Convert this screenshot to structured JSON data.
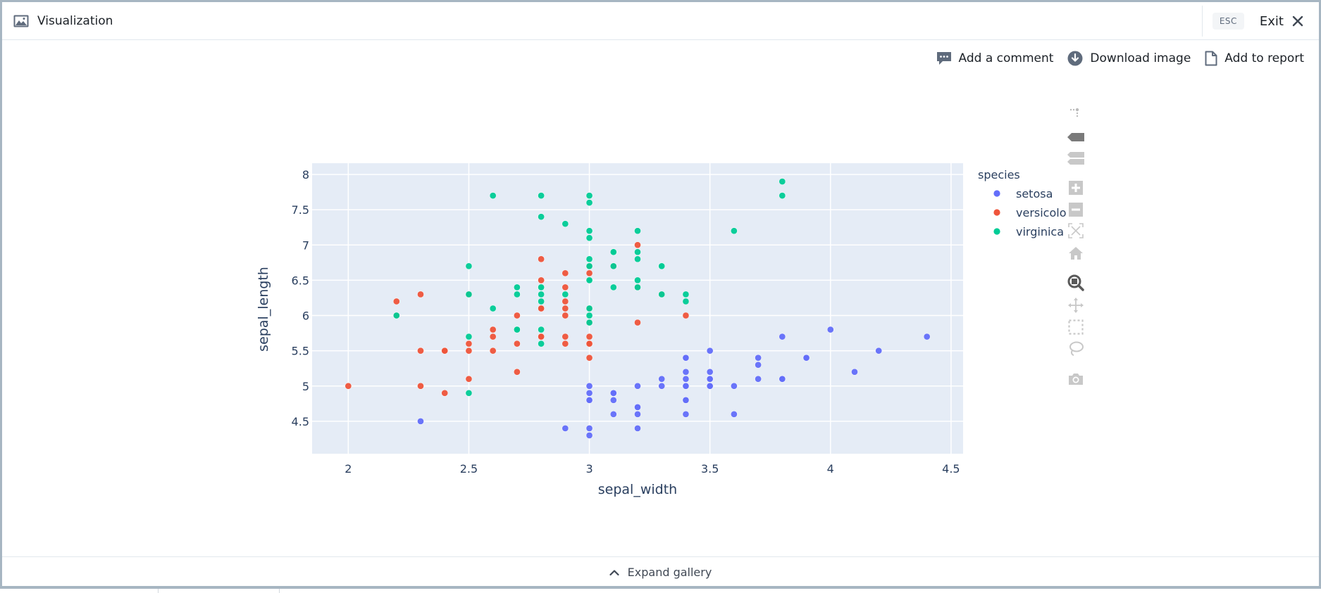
{
  "header": {
    "title": "Visualization",
    "title_icon": "image-icon",
    "esc_label": "ESC",
    "exit_label": "Exit"
  },
  "actions": [
    {
      "label": "Add a comment",
      "icon": "comment-icon"
    },
    {
      "label": "Download image",
      "icon": "download-icon"
    },
    {
      "label": "Add to report",
      "icon": "document-icon"
    }
  ],
  "modebar": [
    {
      "name": "plotly-logo-icon"
    },
    {
      "name": "show-closest-icon"
    },
    {
      "name": "compare-data-icon"
    },
    {
      "name": "zoom-in-icon"
    },
    {
      "name": "zoom-out-icon"
    },
    {
      "name": "autoscale-icon"
    },
    {
      "name": "reset-axes-icon"
    },
    {
      "name": "zoom-icon",
      "active": true
    },
    {
      "name": "pan-icon"
    },
    {
      "name": "box-select-icon"
    },
    {
      "name": "lasso-select-icon"
    },
    {
      "name": "camera-icon"
    }
  ],
  "footer": {
    "expand_label": "Expand gallery"
  },
  "chart_data": {
    "type": "scatter",
    "title": "",
    "xlabel": "sepal_width",
    "ylabel": "sepal_length",
    "xlim": [
      1.85,
      4.55
    ],
    "ylim": [
      4.04,
      8.16
    ],
    "xticks": [
      2,
      2.5,
      3,
      3.5,
      4,
      4.5
    ],
    "xtick_labels": [
      "2",
      "2.5",
      "3",
      "3.5",
      "4",
      "4.5"
    ],
    "yticks": [
      4.5,
      5,
      5.5,
      6,
      6.5,
      7,
      7.5,
      8
    ],
    "ytick_labels": [
      "4.5",
      "5",
      "5.5",
      "6",
      "6.5",
      "7",
      "7.5",
      "8"
    ],
    "grid": true,
    "plot_bgcolor": "#e5ecf6",
    "legend": {
      "title": "species",
      "position": "right"
    },
    "series": [
      {
        "name": "setosa",
        "color": "#636efa",
        "x": [
          3.5,
          3.0,
          3.2,
          3.1,
          3.6,
          3.9,
          3.4,
          3.4,
          2.9,
          3.1,
          3.7,
          3.4,
          3.0,
          3.0,
          4.0,
          4.4,
          3.9,
          3.5,
          3.8,
          3.8,
          3.4,
          3.7,
          3.6,
          3.3,
          3.4,
          3.0,
          3.4,
          3.5,
          3.4,
          3.2,
          3.1,
          3.4,
          4.1,
          4.2,
          3.1,
          3.2,
          3.5,
          3.1,
          3.0,
          3.4,
          3.5,
          2.3,
          3.2,
          3.5,
          3.8,
          3.0,
          3.8,
          3.2,
          3.7,
          3.3
        ],
        "y": [
          5.1,
          4.9,
          4.7,
          4.6,
          5.0,
          5.4,
          4.6,
          5.0,
          4.4,
          4.9,
          5.4,
          4.8,
          4.8,
          4.3,
          5.8,
          5.7,
          5.4,
          5.1,
          5.7,
          5.1,
          5.4,
          5.1,
          4.6,
          5.1,
          4.8,
          5.0,
          5.0,
          5.2,
          5.2,
          4.7,
          4.8,
          5.4,
          5.2,
          5.5,
          4.9,
          5.0,
          5.5,
          4.9,
          4.4,
          5.1,
          5.0,
          4.5,
          4.4,
          5.0,
          5.1,
          4.8,
          5.1,
          4.6,
          5.3,
          5.0
        ]
      },
      {
        "name": "versicolor",
        "color": "#ef553b",
        "x": [
          3.2,
          3.2,
          3.1,
          2.3,
          2.8,
          2.8,
          3.3,
          2.4,
          2.9,
          2.7,
          2.0,
          3.0,
          2.2,
          2.9,
          2.9,
          3.1,
          3.0,
          2.7,
          2.2,
          2.5,
          3.2,
          2.8,
          2.5,
          2.8,
          2.9,
          3.0,
          2.8,
          3.0,
          2.9,
          2.6,
          2.4,
          2.4,
          2.7,
          2.7,
          3.0,
          3.4,
          3.1,
          2.3,
          3.0,
          2.5,
          2.6,
          3.0,
          2.6,
          2.3,
          2.7,
          3.0,
          2.9,
          2.9,
          2.5,
          2.8
        ],
        "y": [
          7.0,
          6.4,
          6.9,
          5.5,
          6.5,
          5.7,
          6.3,
          4.9,
          6.6,
          5.2,
          5.0,
          5.9,
          6.0,
          6.1,
          5.6,
          6.7,
          5.6,
          5.8,
          6.2,
          5.6,
          5.9,
          6.1,
          6.3,
          6.1,
          6.4,
          6.6,
          6.8,
          6.7,
          6.0,
          5.7,
          5.5,
          5.5,
          5.8,
          6.0,
          5.4,
          6.0,
          6.7,
          6.3,
          5.6,
          5.5,
          5.5,
          6.1,
          5.8,
          5.0,
          5.6,
          5.7,
          5.7,
          6.2,
          5.1,
          5.7
        ]
      },
      {
        "name": "virginica",
        "color": "#00cc96",
        "x": [
          3.3,
          2.7,
          3.0,
          2.9,
          3.0,
          3.0,
          2.5,
          2.9,
          2.5,
          3.6,
          3.2,
          2.7,
          3.0,
          2.5,
          2.8,
          3.2,
          3.0,
          3.8,
          2.6,
          2.2,
          3.2,
          2.8,
          2.8,
          2.7,
          3.3,
          3.2,
          2.8,
          3.0,
          2.8,
          3.0,
          2.8,
          3.8,
          2.8,
          2.8,
          2.6,
          3.0,
          3.4,
          3.1,
          3.0,
          3.1,
          3.1,
          3.1,
          2.7,
          3.2,
          3.3,
          3.0,
          2.5,
          3.0,
          3.4,
          3.0
        ],
        "y": [
          6.3,
          5.8,
          7.1,
          6.3,
          6.5,
          7.6,
          4.9,
          7.3,
          6.7,
          7.2,
          6.5,
          6.4,
          6.8,
          5.7,
          5.8,
          6.4,
          6.5,
          7.7,
          7.7,
          6.0,
          6.9,
          5.6,
          7.7,
          6.3,
          6.7,
          7.2,
          6.2,
          6.1,
          6.4,
          7.2,
          7.4,
          7.9,
          6.4,
          6.3,
          6.1,
          7.7,
          6.3,
          6.4,
          6.0,
          6.9,
          6.7,
          6.9,
          5.8,
          6.8,
          6.7,
          6.7,
          6.3,
          6.5,
          6.2,
          5.9
        ]
      }
    ]
  }
}
